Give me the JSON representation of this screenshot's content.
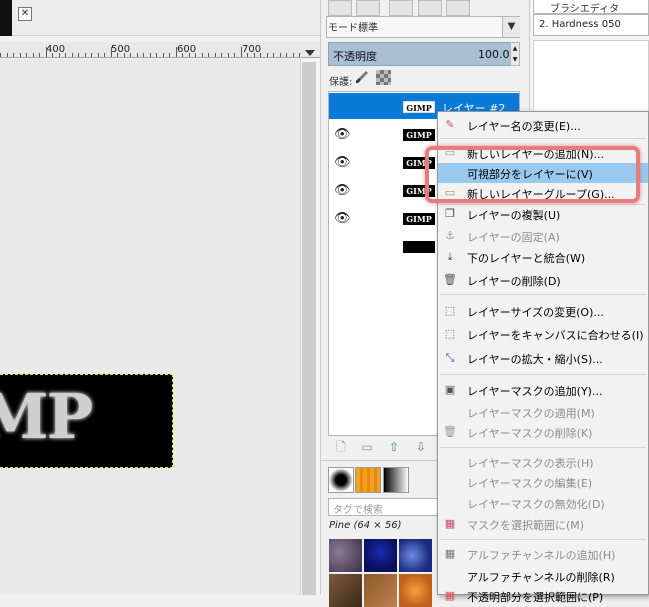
{
  "canvas": {
    "ruler_labels": [
      "400",
      "500",
      "600",
      "700"
    ],
    "image_text": "MP",
    "close_glyph": "✕"
  },
  "layers": {
    "mode_label": "モード:",
    "mode_value": "標準",
    "opacity_label": "不透明度",
    "opacity_value": "100.0",
    "lock_label": "保護:",
    "rows": [
      {
        "name": "レイヤー #2",
        "thumb": "GIMP",
        "selected": true
      },
      {
        "thumb": "GIMP"
      },
      {
        "thumb": "GIMP"
      },
      {
        "thumb": "GIMP"
      },
      {
        "thumb": "GIMP"
      },
      {
        "thumb": ""
      }
    ],
    "bottom_buttons": [
      "new-layer-icon",
      "new-group-icon",
      "raise-icon",
      "lower-icon"
    ]
  },
  "patterns": {
    "tag_placeholder": "タグで検索",
    "pattern_name": "Pine (64 × 56)"
  },
  "brushes": {
    "tab_label": "ブラシエディタ",
    "brush_name": "2. Hardness 050"
  },
  "menu": {
    "items": [
      {
        "label": "レイヤー名の変更(E)...",
        "enabled": true
      },
      {
        "label": "新しいレイヤーの追加(N)...",
        "enabled": true
      },
      {
        "label": "可視部分をレイヤーに(V)",
        "enabled": true,
        "highlighted": true
      },
      {
        "label": "新しいレイヤーグループ(G)...",
        "enabled": true
      },
      {
        "label": "レイヤーの複製(U)",
        "enabled": true
      },
      {
        "label": "レイヤーの固定(A)",
        "enabled": false
      },
      {
        "label": "下のレイヤーと統合(W)",
        "enabled": true
      },
      {
        "label": "レイヤーの削除(D)",
        "enabled": true
      },
      {
        "label": "レイヤーサイズの変更(O)...",
        "enabled": true
      },
      {
        "label": "レイヤーをキャンバスに合わせる(I)",
        "enabled": true
      },
      {
        "label": "レイヤーの拡大・縮小(S)...",
        "enabled": true
      },
      {
        "label": "レイヤーマスクの追加(Y)...",
        "enabled": true
      },
      {
        "label": "レイヤーマスクの適用(M)",
        "enabled": false
      },
      {
        "label": "レイヤーマスクの削除(K)",
        "enabled": false
      },
      {
        "label": "レイヤーマスクの表示(H)",
        "enabled": false
      },
      {
        "label": "レイヤーマスクの編集(E)",
        "enabled": false
      },
      {
        "label": "レイヤーマスクの無効化(D)",
        "enabled": false
      },
      {
        "label": "マスクを選択範囲に(M)",
        "enabled": false
      },
      {
        "label": "アルファチャンネルの追加(H)",
        "enabled": false
      },
      {
        "label": "アルファチャンネルの削除(R)",
        "enabled": true
      },
      {
        "label": "不透明部分を選択範囲に(P)",
        "enabled": true
      }
    ]
  },
  "colors": {
    "selection_blue": "#0a7ad9",
    "menu_highlight": "#99c9ef",
    "callout_red": "#e77c7c"
  }
}
